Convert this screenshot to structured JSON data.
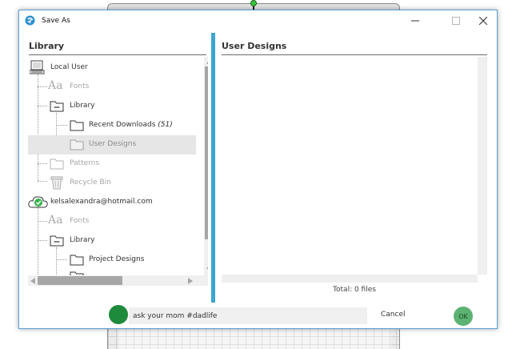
{
  "window": {
    "title": "Save As",
    "accent_color": "#3ba5d1"
  },
  "library": {
    "heading": "Library",
    "items": [
      {
        "label": "Local User",
        "icon": "computer-icon",
        "dim": false
      },
      {
        "label": "Fonts",
        "icon": "font-icon",
        "dim": true
      },
      {
        "label": "Library",
        "icon": "folder-collapse-icon",
        "dim": false
      },
      {
        "label": "Recent Downloads",
        "count": "(51)",
        "icon": "folder-icon",
        "dim": false
      },
      {
        "label": "User Designs",
        "icon": "folder-icon",
        "dim": true,
        "selected": true
      },
      {
        "label": "Patterns",
        "icon": "folder-icon",
        "dim": true
      },
      {
        "label": "Recycle Bin",
        "icon": "recycle-bin-icon",
        "dim": true
      },
      {
        "label": "kelsalexandra@hotmail.com",
        "icon": "cloud-check-icon",
        "dim": false
      },
      {
        "label": "Fonts",
        "icon": "font-icon",
        "dim": true
      },
      {
        "label": "Library",
        "icon": "folder-collapse-icon",
        "dim": false
      },
      {
        "label": "Project Designs",
        "icon": "folder-icon",
        "dim": false
      }
    ]
  },
  "designs": {
    "heading": "User Designs",
    "total": "Total: 0 files"
  },
  "footer": {
    "filename_value": "ask your mom #dadlife",
    "cancel_label": "Cancel",
    "ok_label": "OK"
  }
}
